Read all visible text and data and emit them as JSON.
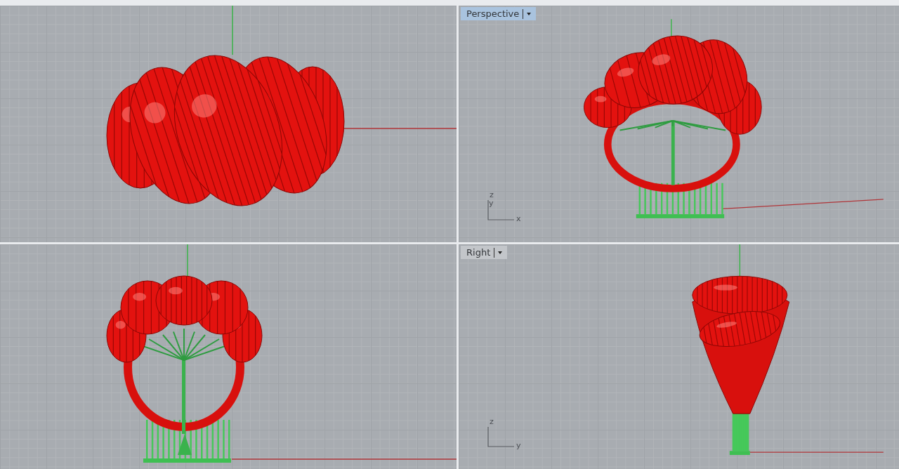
{
  "viewports": [
    {
      "kind": "top"
    },
    {
      "kind": "perspective",
      "label": "Perspective",
      "selected": true,
      "axes": [
        "z",
        "y",
        "x"
      ]
    },
    {
      "kind": "front"
    },
    {
      "kind": "right",
      "label": "Right",
      "selected": false,
      "axes": [
        "z",
        "y"
      ]
    }
  ]
}
